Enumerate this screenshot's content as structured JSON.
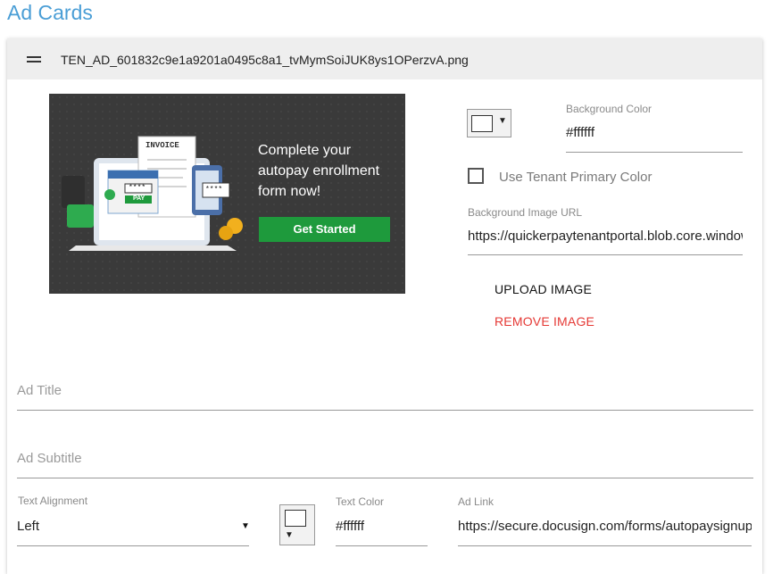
{
  "page": {
    "title": "Ad Cards"
  },
  "card": {
    "filename": "TEN_AD_601832c9e1a9201a0495c8a1_tvMymSoiJUK8ys1OPerzvA.png",
    "preview": {
      "headline": "Complete your autopay enrollment form now!",
      "button_label": "Get Started",
      "invoice_label": "INVOICE",
      "pay_label": "PAY",
      "masked_a": "****",
      "masked_b": "****"
    },
    "background_color": {
      "label": "Background Color",
      "value": "#ffffff"
    },
    "use_tenant_primary": {
      "label": "Use Tenant Primary Color",
      "checked": false
    },
    "background_image_url": {
      "label": "Background Image URL",
      "value": "https://quickerpaytenantportal.blob.core.windows.net"
    },
    "upload_label": "UPLOAD IMAGE",
    "remove_label": "REMOVE IMAGE",
    "ad_title": {
      "placeholder": "Ad Title",
      "value": ""
    },
    "ad_subtitle": {
      "placeholder": "Ad Subtitle",
      "value": ""
    },
    "text_alignment": {
      "label": "Text Alignment",
      "value": "Left"
    },
    "text_color": {
      "label": "Text Color",
      "value": "#ffffff"
    },
    "ad_link": {
      "label": "Ad Link",
      "value": "https://secure.docusign.com/forms/autopaysignup"
    }
  },
  "colors": {
    "accent": "#4a9ed6",
    "danger": "#e53935",
    "cta": "#1e9a3c"
  },
  "icons": {
    "drag": "drag-handle-icon",
    "caret": "caret-down-icon",
    "checkbox": "checkbox-unchecked-icon"
  }
}
